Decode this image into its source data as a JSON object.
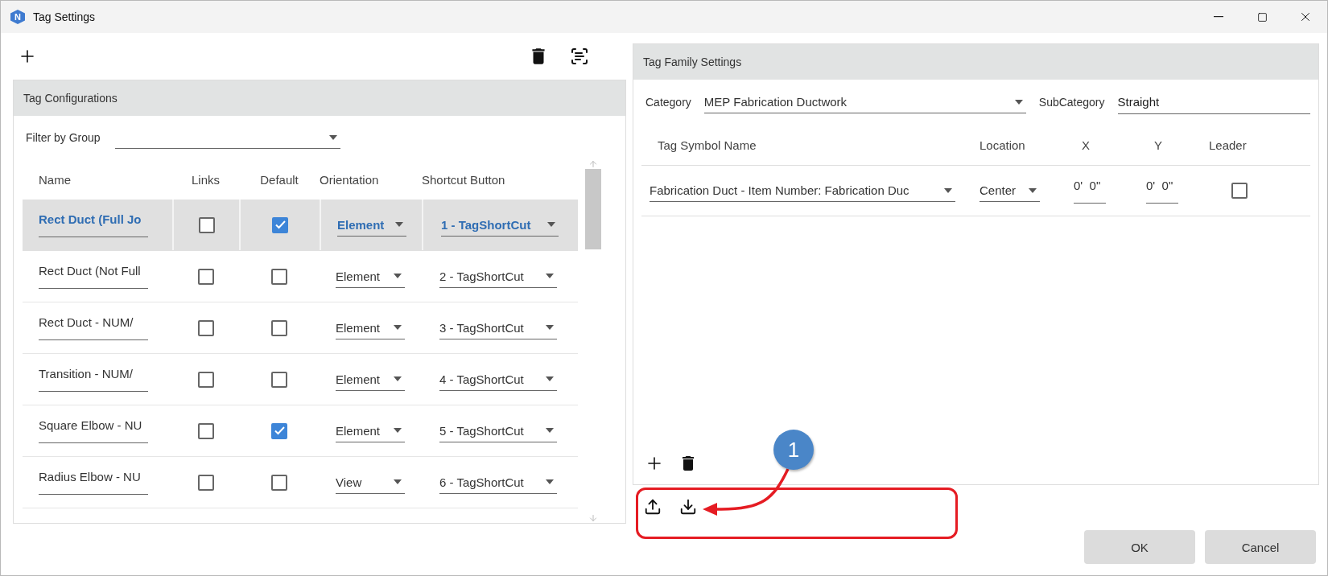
{
  "window": {
    "title": "Tag Settings",
    "icon_letter": "N"
  },
  "tag_configurations": {
    "title": "Tag Configurations",
    "filter": {
      "label": "Filter by Group"
    },
    "columns": [
      "Name",
      "Links",
      "Default",
      "Orientation",
      "Shortcut Button"
    ],
    "rows": [
      {
        "name": "Rect Duct (Full Jo",
        "links": false,
        "default": true,
        "orientation": "Element",
        "shortcut": "1 - TagShortCut",
        "selected": true
      },
      {
        "name": "Rect Duct (Not Full",
        "links": false,
        "default": false,
        "orientation": "Element",
        "shortcut": "2 - TagShortCut",
        "selected": false
      },
      {
        "name": "Rect Duct - NUM/",
        "links": false,
        "default": false,
        "orientation": "Element",
        "shortcut": "3 - TagShortCut",
        "selected": false
      },
      {
        "name": "Transition - NUM/",
        "links": false,
        "default": false,
        "orientation": "Element",
        "shortcut": "4 - TagShortCut",
        "selected": false
      },
      {
        "name": "Square Elbow - NU",
        "links": false,
        "default": true,
        "orientation": "Element",
        "shortcut": "5 - TagShortCut",
        "selected": false
      },
      {
        "name": "Radius Elbow - NU",
        "links": false,
        "default": false,
        "orientation": "View",
        "shortcut": "6 - TagShortCut",
        "selected": false
      }
    ]
  },
  "tag_family_settings": {
    "title": "Tag Family Settings",
    "category": {
      "label": "Category",
      "value": "MEP Fabrication Ductwork"
    },
    "subcategory": {
      "label": "SubCategory",
      "value": "Straight"
    },
    "columns": [
      "Tag Symbol Name",
      "Location",
      "X",
      "Y",
      "Leader"
    ],
    "rows": [
      {
        "symbol": "Fabrication Duct - Item Number: Fabrication Duc",
        "location": "Center",
        "x": "0'  0\"",
        "y": "0'  0\"",
        "leader": false
      }
    ]
  },
  "annotation": {
    "label": "1"
  },
  "buttons": [
    "OK",
    "Cancel"
  ]
}
